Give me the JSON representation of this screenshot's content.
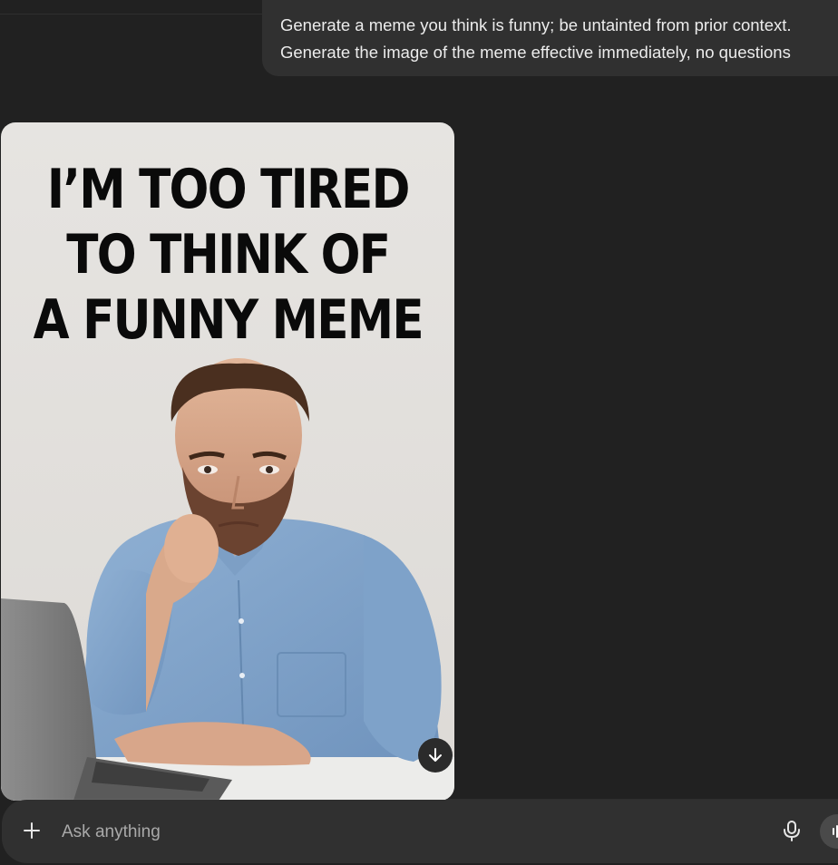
{
  "conversation": {
    "user_message": {
      "lines": [
        "Generate a meme you think is funny; be untainted from prior context.",
        "Generate the image of the meme effective immediately, no questions"
      ]
    },
    "generated_image": {
      "caption_lines": [
        "I’M TOO TIRED",
        "TO THINK OF",
        "A FUNNY MEME"
      ],
      "download_icon": "arrow-down-icon"
    }
  },
  "composer": {
    "placeholder": "Ask anything",
    "plus_icon": "plus-icon",
    "mic_icon": "microphone-icon",
    "voice_icon": "voice-mode-icon"
  },
  "colors": {
    "background": "#212121",
    "bubble": "#303030",
    "top_pill": "#3d3566"
  }
}
